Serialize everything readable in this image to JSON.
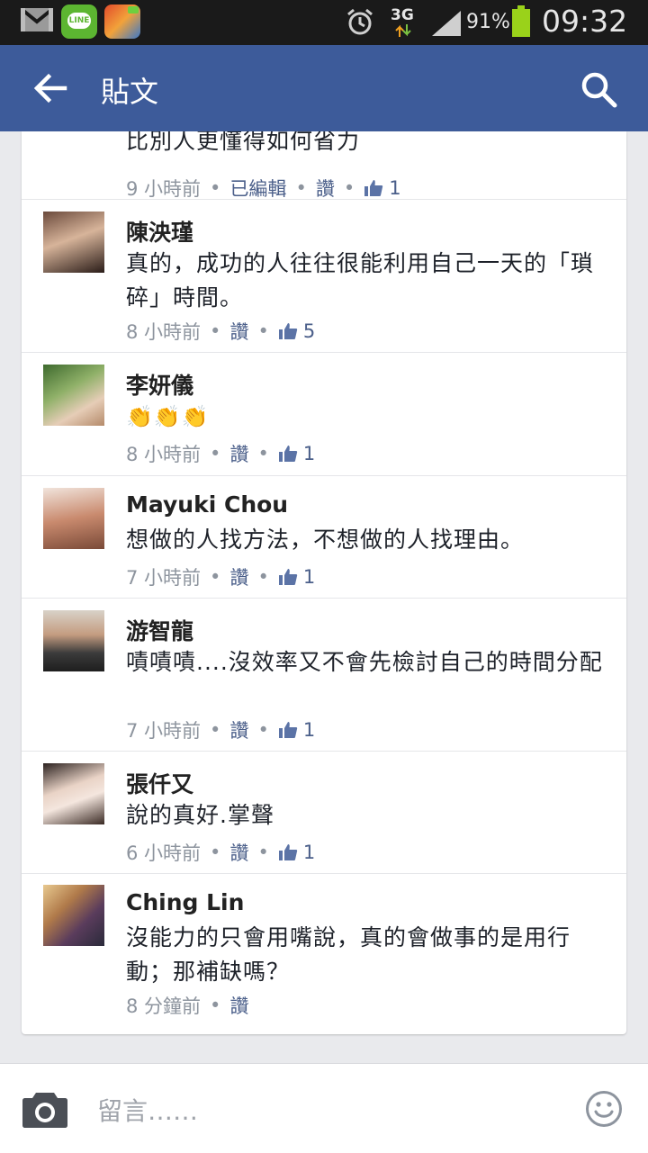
{
  "status_bar": {
    "network": "3G",
    "battery_percent": "91%",
    "battery_level": 0.91,
    "time": "09:32",
    "line_label": "LINE",
    "icons": [
      "gmail-icon",
      "line-app-icon",
      "game-app-icon",
      "alarm-icon",
      "network-3g-icon",
      "signal-icon",
      "battery-icon"
    ]
  },
  "header": {
    "title": "貼文"
  },
  "comments": [
    {
      "name": "",
      "text": "比別人更懂得如何省力",
      "time": "9 小時前",
      "edited": "已編輯",
      "like_label": "讚",
      "likes": "1"
    },
    {
      "name": "陳泱瑾",
      "text": "真的，成功的人往往很能利用自己一天的「瑣碎」時間。",
      "time": "8 小時前",
      "like_label": "讚",
      "likes": "5"
    },
    {
      "name": "李妍儀",
      "text": "👏👏👏",
      "time": "8 小時前",
      "like_label": "讚",
      "likes": "1"
    },
    {
      "name": "Mayuki Chou",
      "text": "想做的人找方法，不想做的人找理由。",
      "time": "7 小時前",
      "like_label": "讚",
      "likes": "1"
    },
    {
      "name": "游智龍",
      "text": "嘖嘖嘖....沒效率又不會先檢討自己的時間分配",
      "time": "7 小時前",
      "like_label": "讚",
      "likes": "1"
    },
    {
      "name": "張仟又",
      "text": "說的真好.掌聲",
      "time": "6 小時前",
      "like_label": "讚",
      "likes": "1"
    },
    {
      "name": "Ching Lin",
      "text": "沒能力的只會用嘴說，真的會做事的是用行動；那補缺嗎？",
      "time": "8 分鐘前",
      "like_label": "讚",
      "likes": ""
    }
  ],
  "composer": {
    "placeholder": "留言……"
  },
  "colors": {
    "header_bg": "#3d5b9a",
    "link": "#4b5f8a",
    "meta": "#8d949e"
  }
}
